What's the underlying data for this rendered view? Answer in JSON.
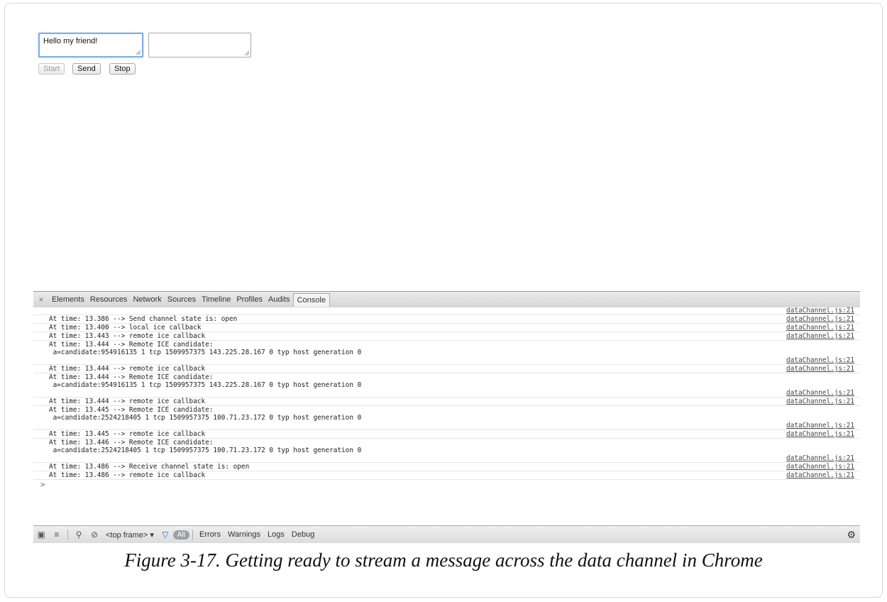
{
  "page": {
    "send_text": "Hello my friend!",
    "receive_text": "",
    "buttons": {
      "start": "Start",
      "send": "Send",
      "stop": "Stop"
    }
  },
  "devtools": {
    "close": "×",
    "tabs": [
      "Elements",
      "Resources",
      "Network",
      "Sources",
      "Timeline",
      "Profiles",
      "Audits",
      "Console"
    ],
    "active_tab": "Console",
    "first_source": "dataChannel.js:21",
    "logs": [
      {
        "msg": "At time: 13.386 --> Send channel state is: open",
        "src": "dataChannel.js:21"
      },
      {
        "msg": "At time: 13.400 --> local ice callback",
        "src": "dataChannel.js:21"
      },
      {
        "msg": "At time: 13.443 --> remote ice callback",
        "src": "dataChannel.js:21"
      },
      {
        "msg": "At time: 13.444 --> Remote ICE candidate:\n a=candidate:954916135 1 tcp 1509957375 143.225.28.167 0 typ host generation 0",
        "src": "dataChannel.js:21"
      },
      {
        "msg": "At time: 13.444 --> remote ice callback",
        "src": "dataChannel.js:21"
      },
      {
        "msg": "At time: 13.444 --> Remote ICE candidate:\n a=candidate:954916135 1 tcp 1509957375 143.225.28.167 0 typ host generation 0",
        "src": "dataChannel.js:21"
      },
      {
        "msg": "At time: 13.444 --> remote ice callback",
        "src": "dataChannel.js:21"
      },
      {
        "msg": "At time: 13.445 --> Remote ICE candidate:\n a=candidate:2524218405 1 tcp 1509957375 100.71.23.172 0 typ host generation 0",
        "src": "dataChannel.js:21"
      },
      {
        "msg": "At time: 13.445 --> remote ice callback",
        "src": "dataChannel.js:21"
      },
      {
        "msg": "At time: 13.446 --> Remote ICE candidate:\n a=candidate:2524218405 1 tcp 1509957375 100.71.23.172 0 typ host generation 0",
        "src": "dataChannel.js:21"
      },
      {
        "msg": "At time: 13.486 --> Receive channel state is: open",
        "src": "dataChannel.js:21"
      },
      {
        "msg": "At time: 13.486 --> remote ice callback",
        "src": "dataChannel.js:21"
      }
    ],
    "prompt": ">",
    "bottom": {
      "frame_select": "<top frame> ▾",
      "all": "All",
      "filters": [
        "Errors",
        "Warnings",
        "Logs",
        "Debug"
      ]
    }
  },
  "caption": "Figure 3-17. Getting ready to stream a message across the data channel in Chrome"
}
